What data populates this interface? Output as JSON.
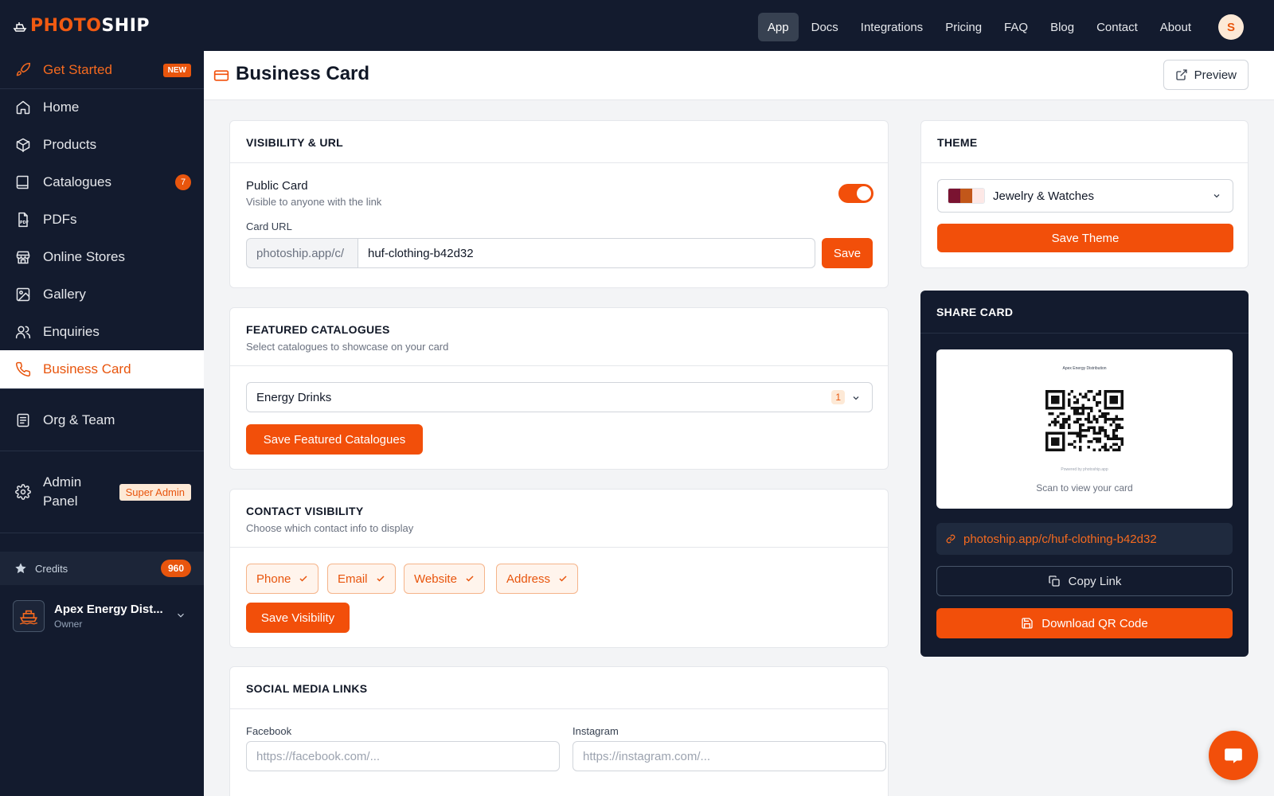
{
  "brand": {
    "part1": "PHOTO",
    "part2": "SHIP"
  },
  "topnav": {
    "items": [
      {
        "label": "App",
        "active": true
      },
      {
        "label": "Docs"
      },
      {
        "label": "Integrations"
      },
      {
        "label": "Pricing"
      },
      {
        "label": "FAQ"
      },
      {
        "label": "Blog"
      },
      {
        "label": "Contact"
      },
      {
        "label": "About"
      }
    ]
  },
  "user": {
    "initial": "S"
  },
  "sidebar": {
    "get_started": {
      "label": "Get Started",
      "badge": "NEW"
    },
    "items": [
      {
        "label": "Home",
        "icon": "home-icon"
      },
      {
        "label": "Products",
        "icon": "box-icon"
      },
      {
        "label": "Catalogues",
        "icon": "book-icon",
        "badge": "7"
      },
      {
        "label": "PDFs",
        "icon": "pdf-icon"
      },
      {
        "label": "Online Stores",
        "icon": "store-icon"
      },
      {
        "label": "Gallery",
        "icon": "image-icon"
      },
      {
        "label": "Enquiries",
        "icon": "users-icon"
      },
      {
        "label": "Business Card",
        "icon": "phone-icon",
        "active": true
      }
    ],
    "org_team": {
      "label": "Org & Team"
    },
    "admin": {
      "line1": "Admin",
      "line2": "Panel",
      "badge": "Super Admin"
    },
    "credits": {
      "label": "Credits",
      "count": "960"
    },
    "org": {
      "name": "Apex Energy Dist...",
      "role": "Owner"
    }
  },
  "page": {
    "title": "Business Card",
    "preview_label": "Preview"
  },
  "visibility": {
    "title": "VISIBILITY & URL",
    "public_label": "Public Card",
    "public_desc": "Visible to anyone with the link",
    "public_on": true,
    "url_label": "Card URL",
    "url_prefix": "photoship.app/c/",
    "url_value": "huf-clothing-b42d32",
    "save_label": "Save"
  },
  "featured": {
    "title": "FEATURED CATALOGUES",
    "subtitle": "Select catalogues to showcase on your card",
    "selected": "Energy Drinks",
    "count": "1",
    "save_label": "Save Featured Catalogues"
  },
  "contact": {
    "title": "CONTACT VISIBILITY",
    "subtitle": "Choose which contact info to display",
    "chips": [
      "Phone",
      "Email",
      "Website",
      "Address"
    ],
    "save_label": "Save Visibility"
  },
  "social": {
    "title": "SOCIAL MEDIA LINKS",
    "facebook_label": "Facebook",
    "facebook_placeholder": "https://facebook.com/...",
    "instagram_label": "Instagram",
    "instagram_placeholder": "https://instagram.com/..."
  },
  "theme": {
    "title": "THEME",
    "selected": "Jewelry & Watches",
    "swatches": [
      "#7a1331",
      "#c2571a",
      "#fde8e6"
    ],
    "save_label": "Save Theme"
  },
  "share": {
    "title": "SHARE CARD",
    "card_name": "Apex Energy Distribution",
    "powered": "Powered by photoship.app",
    "scan_text": "Scan to view your card",
    "link": "photoship.app/c/huf-clothing-b42d32",
    "copy_label": "Copy Link",
    "download_label": "Download QR Code"
  },
  "colors": {
    "accent": "#f24f0a",
    "sidebar_bg": "#131b2e"
  }
}
